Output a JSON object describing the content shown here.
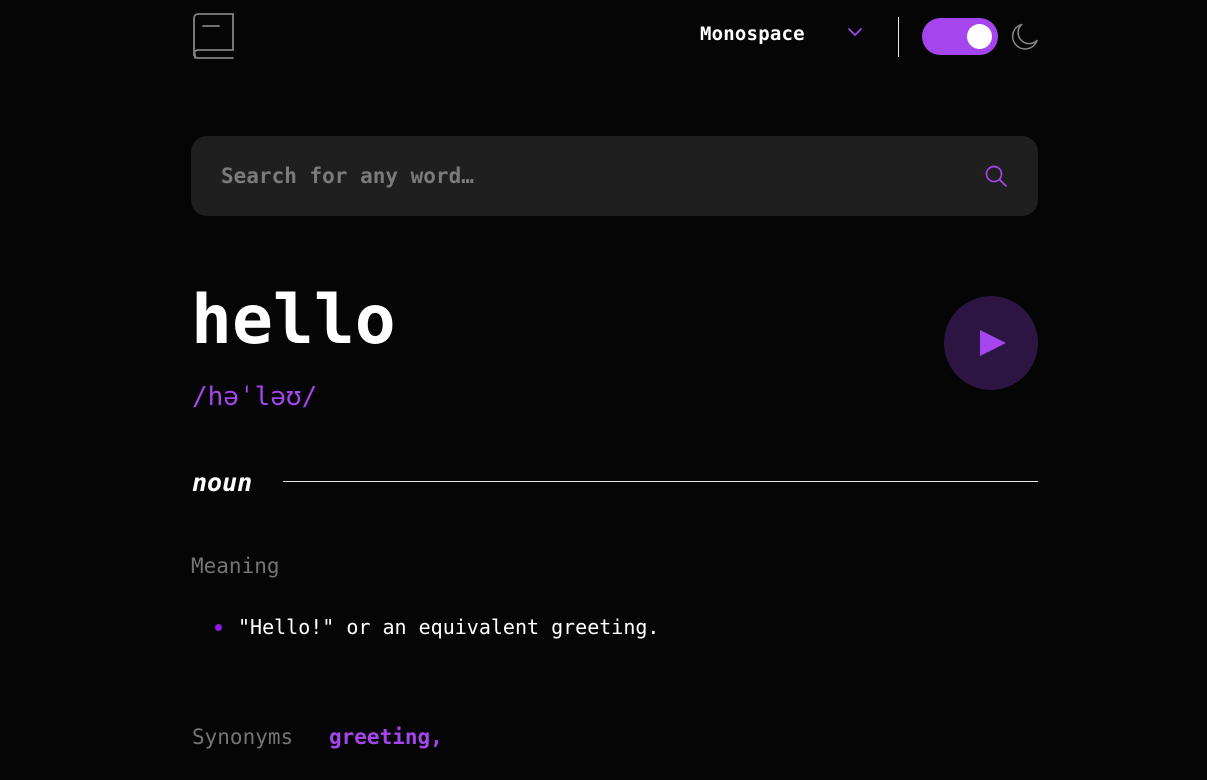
{
  "header": {
    "logo_icon": "book-icon",
    "font_selector": {
      "selected": "Monospace",
      "icon": "chevron-down-icon"
    },
    "theme_toggle": {
      "state": "dark",
      "on": true,
      "icon": "moon-icon"
    }
  },
  "search": {
    "value": "",
    "placeholder": "Search for any word…",
    "icon": "search-icon"
  },
  "entry": {
    "word": "hello",
    "phonetic": "/həˈləʊ/",
    "play_icon": "play-icon",
    "meanings": [
      {
        "part_of_speech": "noun",
        "label": "Meaning",
        "definitions": [
          "\"Hello!\" or an equivalent greeting."
        ],
        "synonyms_label": "Synonyms",
        "synonyms": [
          "greeting,"
        ]
      }
    ]
  },
  "colors": {
    "background": "#050505",
    "accent": "#a445ed",
    "surface": "#1f1f1f",
    "muted_text": "#757575",
    "play_button_bg": "#2d1543"
  }
}
